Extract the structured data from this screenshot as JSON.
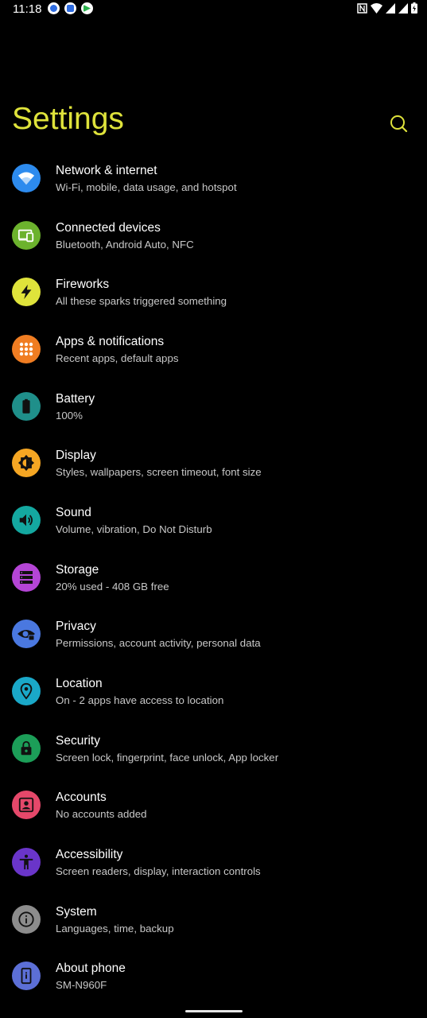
{
  "status_bar": {
    "time": "11:18"
  },
  "header": {
    "title": "Settings",
    "accent_color": "#dfe33b"
  },
  "items": [
    {
      "title": "Network & internet",
      "subtitle": "Wi-Fi, mobile, data usage, and hotspot",
      "icon": "wifi-icon",
      "color": "#2d8bee"
    },
    {
      "title": "Connected devices",
      "subtitle": "Bluetooth, Android Auto, NFC",
      "icon": "devices-icon",
      "color": "#6cb22d"
    },
    {
      "title": "Fireworks",
      "subtitle": "All these sparks triggered something",
      "icon": "bolt-icon",
      "color": "#dfe33b"
    },
    {
      "title": "Apps & notifications",
      "subtitle": "Recent apps, default apps",
      "icon": "apps-grid-icon",
      "color": "#f07d22"
    },
    {
      "title": "Battery",
      "subtitle": "100%",
      "icon": "battery-icon",
      "color": "#1f8f8a"
    },
    {
      "title": "Display",
      "subtitle": "Styles, wallpapers, screen timeout, font size",
      "icon": "brightness-icon",
      "color": "#f5a623"
    },
    {
      "title": "Sound",
      "subtitle": "Volume, vibration, Do Not Disturb",
      "icon": "volume-icon",
      "color": "#14a8a0"
    },
    {
      "title": "Storage",
      "subtitle": "20% used - 408 GB free",
      "icon": "storage-icon",
      "color": "#b545d6"
    },
    {
      "title": "Privacy",
      "subtitle": "Permissions, account activity, personal data",
      "icon": "privacy-eye-icon",
      "color": "#4a78e0"
    },
    {
      "title": "Location",
      "subtitle": "On - 2 apps have access to location",
      "icon": "location-pin-icon",
      "color": "#1aa8c8"
    },
    {
      "title": "Security",
      "subtitle": "Screen lock, fingerprint, face unlock, App locker",
      "icon": "lock-icon",
      "color": "#1c9e58"
    },
    {
      "title": "Accounts",
      "subtitle": "No accounts added",
      "icon": "account-box-icon",
      "color": "#e5486a"
    },
    {
      "title": "Accessibility",
      "subtitle": "Screen readers, display, interaction controls",
      "icon": "accessibility-icon",
      "color": "#6a35c9"
    },
    {
      "title": "System",
      "subtitle": "Languages, time, backup",
      "icon": "info-icon",
      "color": "#8c8c8c"
    },
    {
      "title": "About phone",
      "subtitle": "SM-N960F",
      "icon": "phone-info-icon",
      "color": "#5c6fd6"
    }
  ]
}
